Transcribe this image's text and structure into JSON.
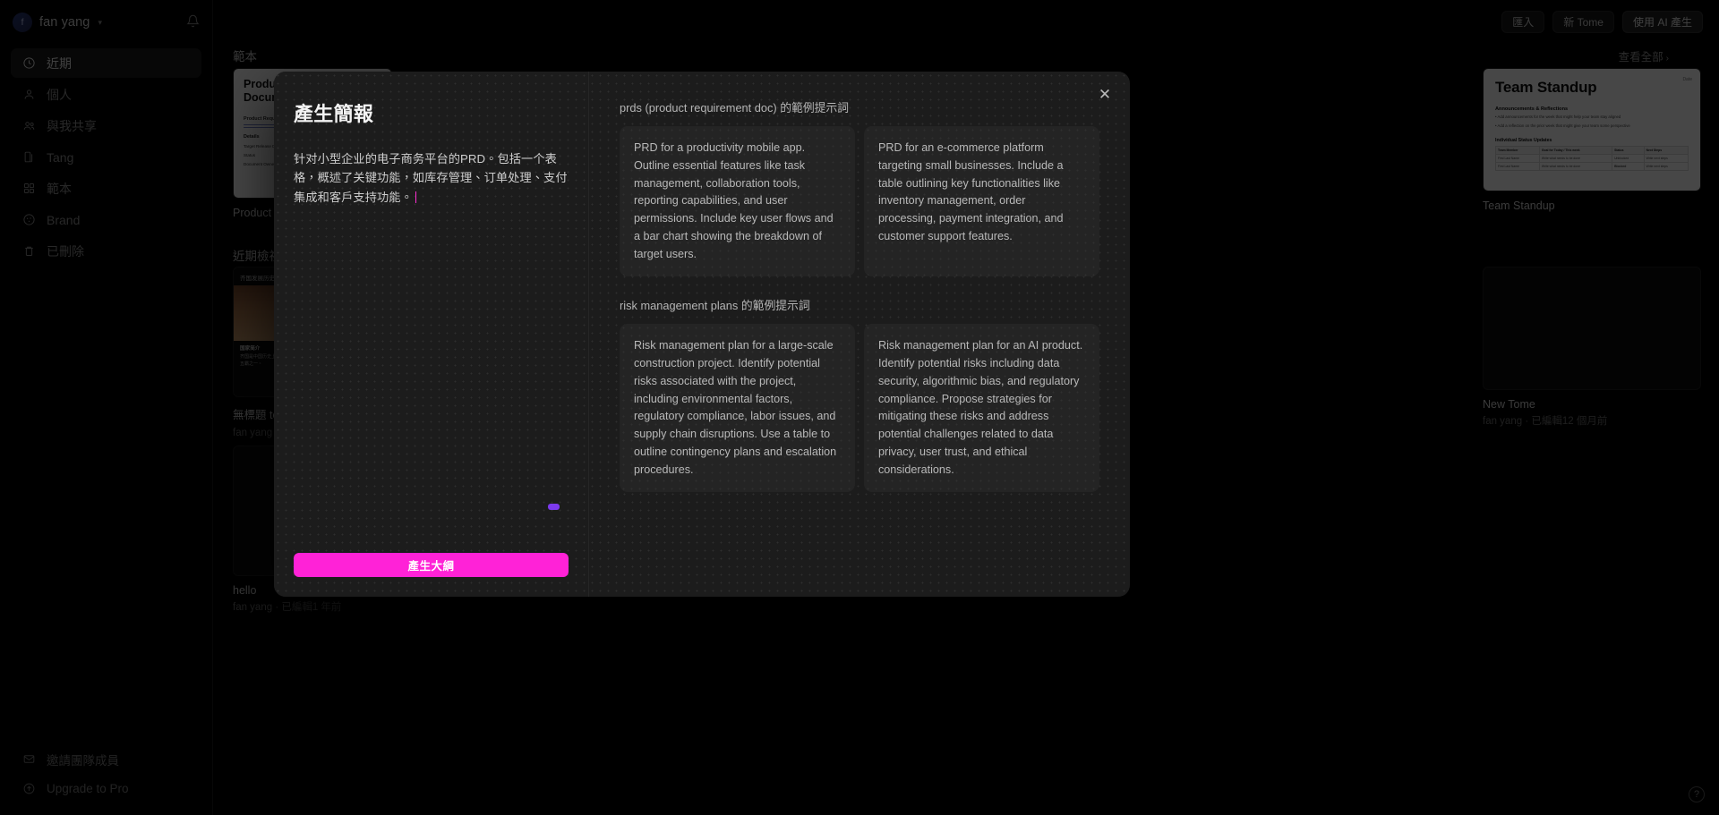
{
  "sidebar": {
    "user": {
      "name": "fan yang",
      "initial": "f"
    },
    "nav_items": [
      {
        "label": "近期",
        "icon": "clock-icon",
        "active": true
      },
      {
        "label": "個人",
        "icon": "user-icon",
        "active": false
      },
      {
        "label": "與我共享",
        "icon": "users-icon",
        "active": false
      },
      {
        "label": "Tang",
        "icon": "page-icon",
        "active": false
      },
      {
        "label": "範本",
        "icon": "grid-icon",
        "active": false
      },
      {
        "label": "Brand",
        "icon": "palette-icon",
        "active": false
      },
      {
        "label": "已刪除",
        "icon": "trash-icon",
        "active": false
      }
    ],
    "bottom_items": [
      {
        "label": "邀請團隊成員",
        "icon": "mail-icon"
      },
      {
        "label": "Upgrade to Pro",
        "icon": "upgrade-icon"
      }
    ]
  },
  "topbar": {
    "import_label": "匯入",
    "new_tome_label": "新 Tome",
    "ai_create_label": "使用 AI 產生"
  },
  "sections": {
    "templates": {
      "title": "範本",
      "view_all": "查看全部",
      "view_all_arrow": "›"
    },
    "recent": {
      "title": "近期檢視"
    }
  },
  "template_cards": [
    {
      "title": "Product Requireme",
      "doc_heading": "Product Requir\nDocument",
      "doc_sub": "Product Requirement Sp",
      "doc_sec": "Details",
      "doc_rows": [
        "Target Release Date",
        "Status",
        "Document Owner"
      ]
    }
  ],
  "standup_card": {
    "title": "Team Standup",
    "heading": "Team Standup",
    "date_label": "Date",
    "section1": "Announcements & Reflections",
    "bullets": [
      "Add announcements for the week that might help your team stay aligned",
      "Add a reflection on the prior week that might give your team some perspective"
    ],
    "section2": "Individual Status Updates",
    "table_headers": [
      "Team Member",
      "Goal for Today / This week",
      "Status",
      "Next Steps"
    ],
    "table_rows": [
      [
        "First Last Name",
        "Write what needs to be done",
        "Unblocked",
        "Write next steps"
      ],
      [
        "First Last Name",
        "Write what needs to be done",
        "Blocked",
        "Write next steps"
      ]
    ]
  },
  "recent_cards": [
    {
      "title": "無標題 tome",
      "subtitle": "fan yang · 已編輯",
      "thumb_heading": "齐国发展历史",
      "thumb_caption_title": "国家简介",
      "thumb_caption": "齐国是中国历史上一个重要的诸侯国，其历史可追溯至西周时期，是春秋五霸之一。"
    },
    {
      "title": "hello",
      "subtitle": "fan yang · 已編輯1 年前"
    }
  ],
  "right_cards": [
    {
      "title": "Team Standup",
      "subtitle": ""
    },
    {
      "title": "New Tome",
      "subtitle": "fan yang · 已編輯12 個月前"
    }
  ],
  "modal": {
    "title": "產生簡報",
    "prompt_value": "针对小型企业的电子商务平台的PRD。包括一个表格，概述了关键功能，如库存管理、订单处理、支付集成和客户支持功能。",
    "generate_label": "產生大綱",
    "close_label": "✕",
    "example_sections": [
      {
        "heading": "prds (product requirement doc) 的範例提示詞",
        "cards": [
          "PRD for a productivity mobile app. Outline essential features like task management, collaboration tools, reporting capabilities, and user permissions. Include key user flows and a bar chart showing the breakdown of target users.",
          "PRD for an e-commerce platform targeting small businesses. Include a table outlining key functionalities like inventory management, order processing, payment integration, and customer support features."
        ]
      },
      {
        "heading": "risk management plans 的範例提示詞",
        "cards": [
          "Risk management plan for a large-scale construction project. Identify potential risks associated with the project, including environmental factors, regulatory compliance, labor issues, and supply chain disruptions. Use a table to outline contingency plans and escalation procedures.",
          "Risk management plan for an AI product. Identify potential risks including data security, algorithmic bias, and regulatory compliance. Propose strategies for mitigating these risks and address potential challenges related to data privacy, user trust, and ethical considerations."
        ]
      }
    ]
  },
  "help": {
    "label": "?"
  },
  "colors": {
    "accent_pink": "#ff22d7",
    "accent_purple": "#7c3aed",
    "caret": "#ff2fd0"
  }
}
